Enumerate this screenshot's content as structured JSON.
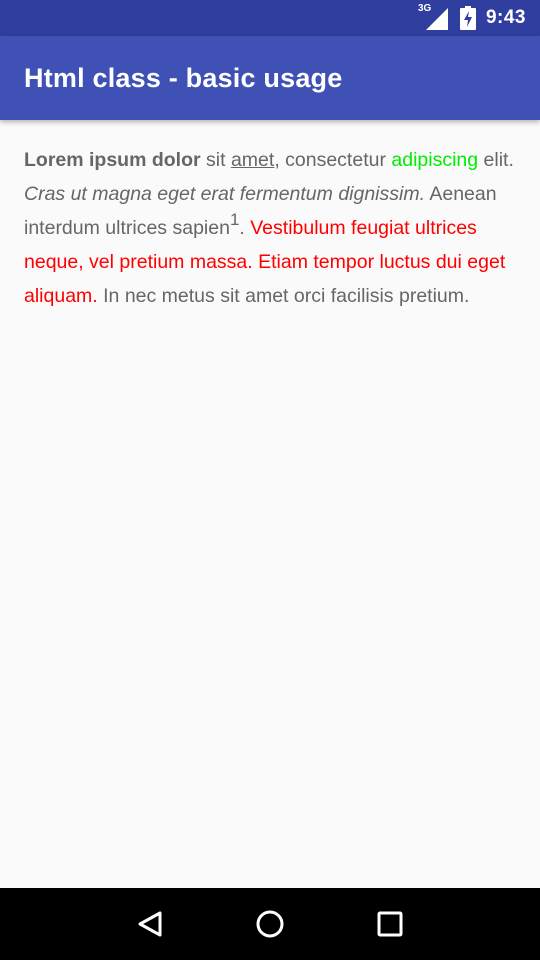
{
  "status_bar": {
    "network_label": "3G",
    "time": "9:43"
  },
  "app_bar": {
    "title": "Html class - basic usage"
  },
  "content": {
    "bold_text": "Lorem ipsum dolor",
    "text_1": " sit ",
    "underlined_text": "amet",
    "text_2": ", consectetur ",
    "green_text": "adipiscing",
    "text_3": " elit. ",
    "italic_text": "Cras ut magna eget erat fermentum dignissim.",
    "text_4": " Aenean interdum ultrices sapien",
    "superscript": "1",
    "text_5": ". ",
    "red_text": "Vestibulum feugiat ultrices neque, vel pretium massa. Etiam tempor luctus dui eget aliquam.",
    "text_6": " In nec metus sit amet orci facilisis pretium."
  },
  "nav_bar": {
    "back_icon": "triangle-back-icon",
    "home_icon": "circle-home-icon",
    "recents_icon": "square-recents-icon"
  },
  "colors": {
    "status_bar": "#303f9f",
    "app_bar": "#3f51b5",
    "body_text": "#666666",
    "green": "#00ee00",
    "red": "#ff0000"
  }
}
